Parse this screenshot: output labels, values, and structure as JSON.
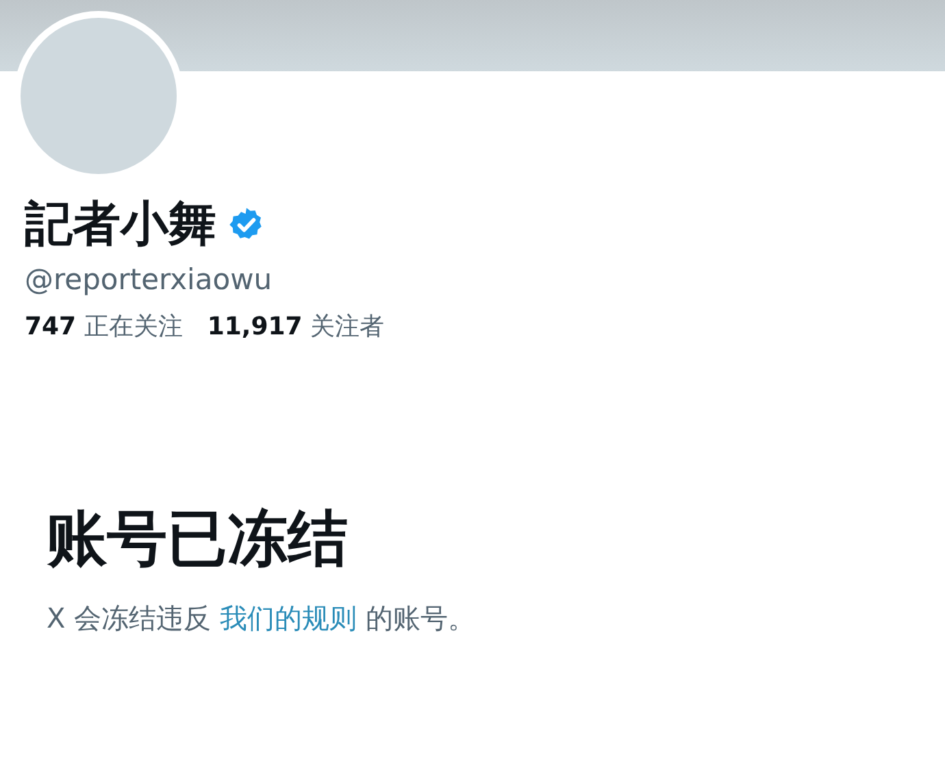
{
  "profile": {
    "name": "記者小舞",
    "verified": true,
    "handle": "@reporterxiaowu",
    "stats": [
      "**747** 正在关注",
      "**11,917** 关注者"
    ]
  },
  "notice": {
    "title": "账号已冻结",
    "text_before": "X 会冻结违反 ",
    "link": "我们的规则",
    "text_after": " 的账号。"
  }
}
